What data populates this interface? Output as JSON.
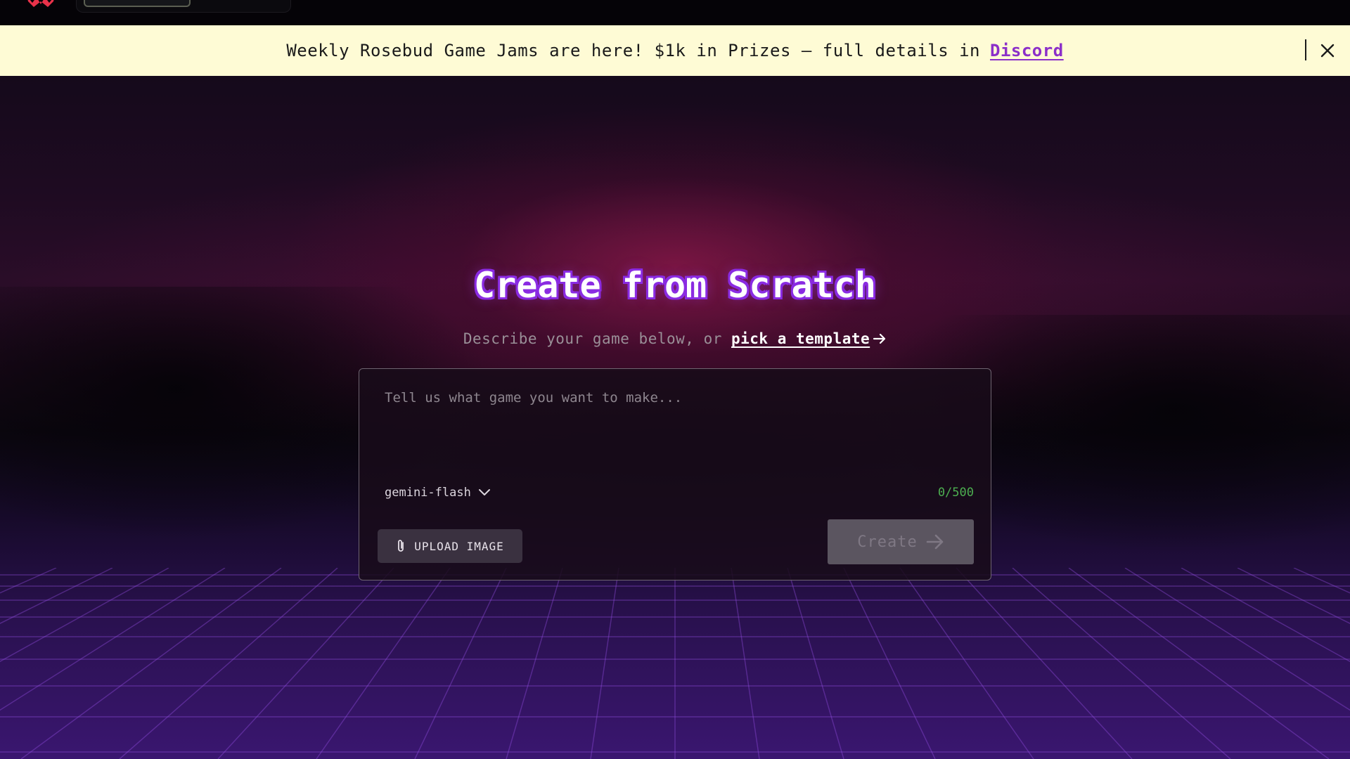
{
  "banner": {
    "text": "Weekly Rosebud Game Jams are here! $1k in Prizes — full details in",
    "link": "Discord"
  },
  "hero": {
    "title": "Create from Scratch",
    "subtitle_prefix": "Describe your game below, or ",
    "subtitle_link": "pick a template"
  },
  "prompt": {
    "placeholder": "Tell us what game you want to make...",
    "value": "",
    "model": "gemini-flash",
    "char_count": "0/500",
    "upload_label": "UPLOAD IMAGE",
    "create_label": "Create"
  },
  "colors": {
    "banner_bg": "#fefbd5",
    "link_purple": "#8b2fc9",
    "title_outline": "#8a2be2",
    "counter_green": "#4caf50",
    "create_disabled_bg": "#5b5560"
  },
  "icons": {
    "logo": "rosebud-logo",
    "close": "close-icon",
    "arrow": "arrow-right-icon",
    "chevron": "chevron-down-icon",
    "clip": "paperclip-icon"
  }
}
